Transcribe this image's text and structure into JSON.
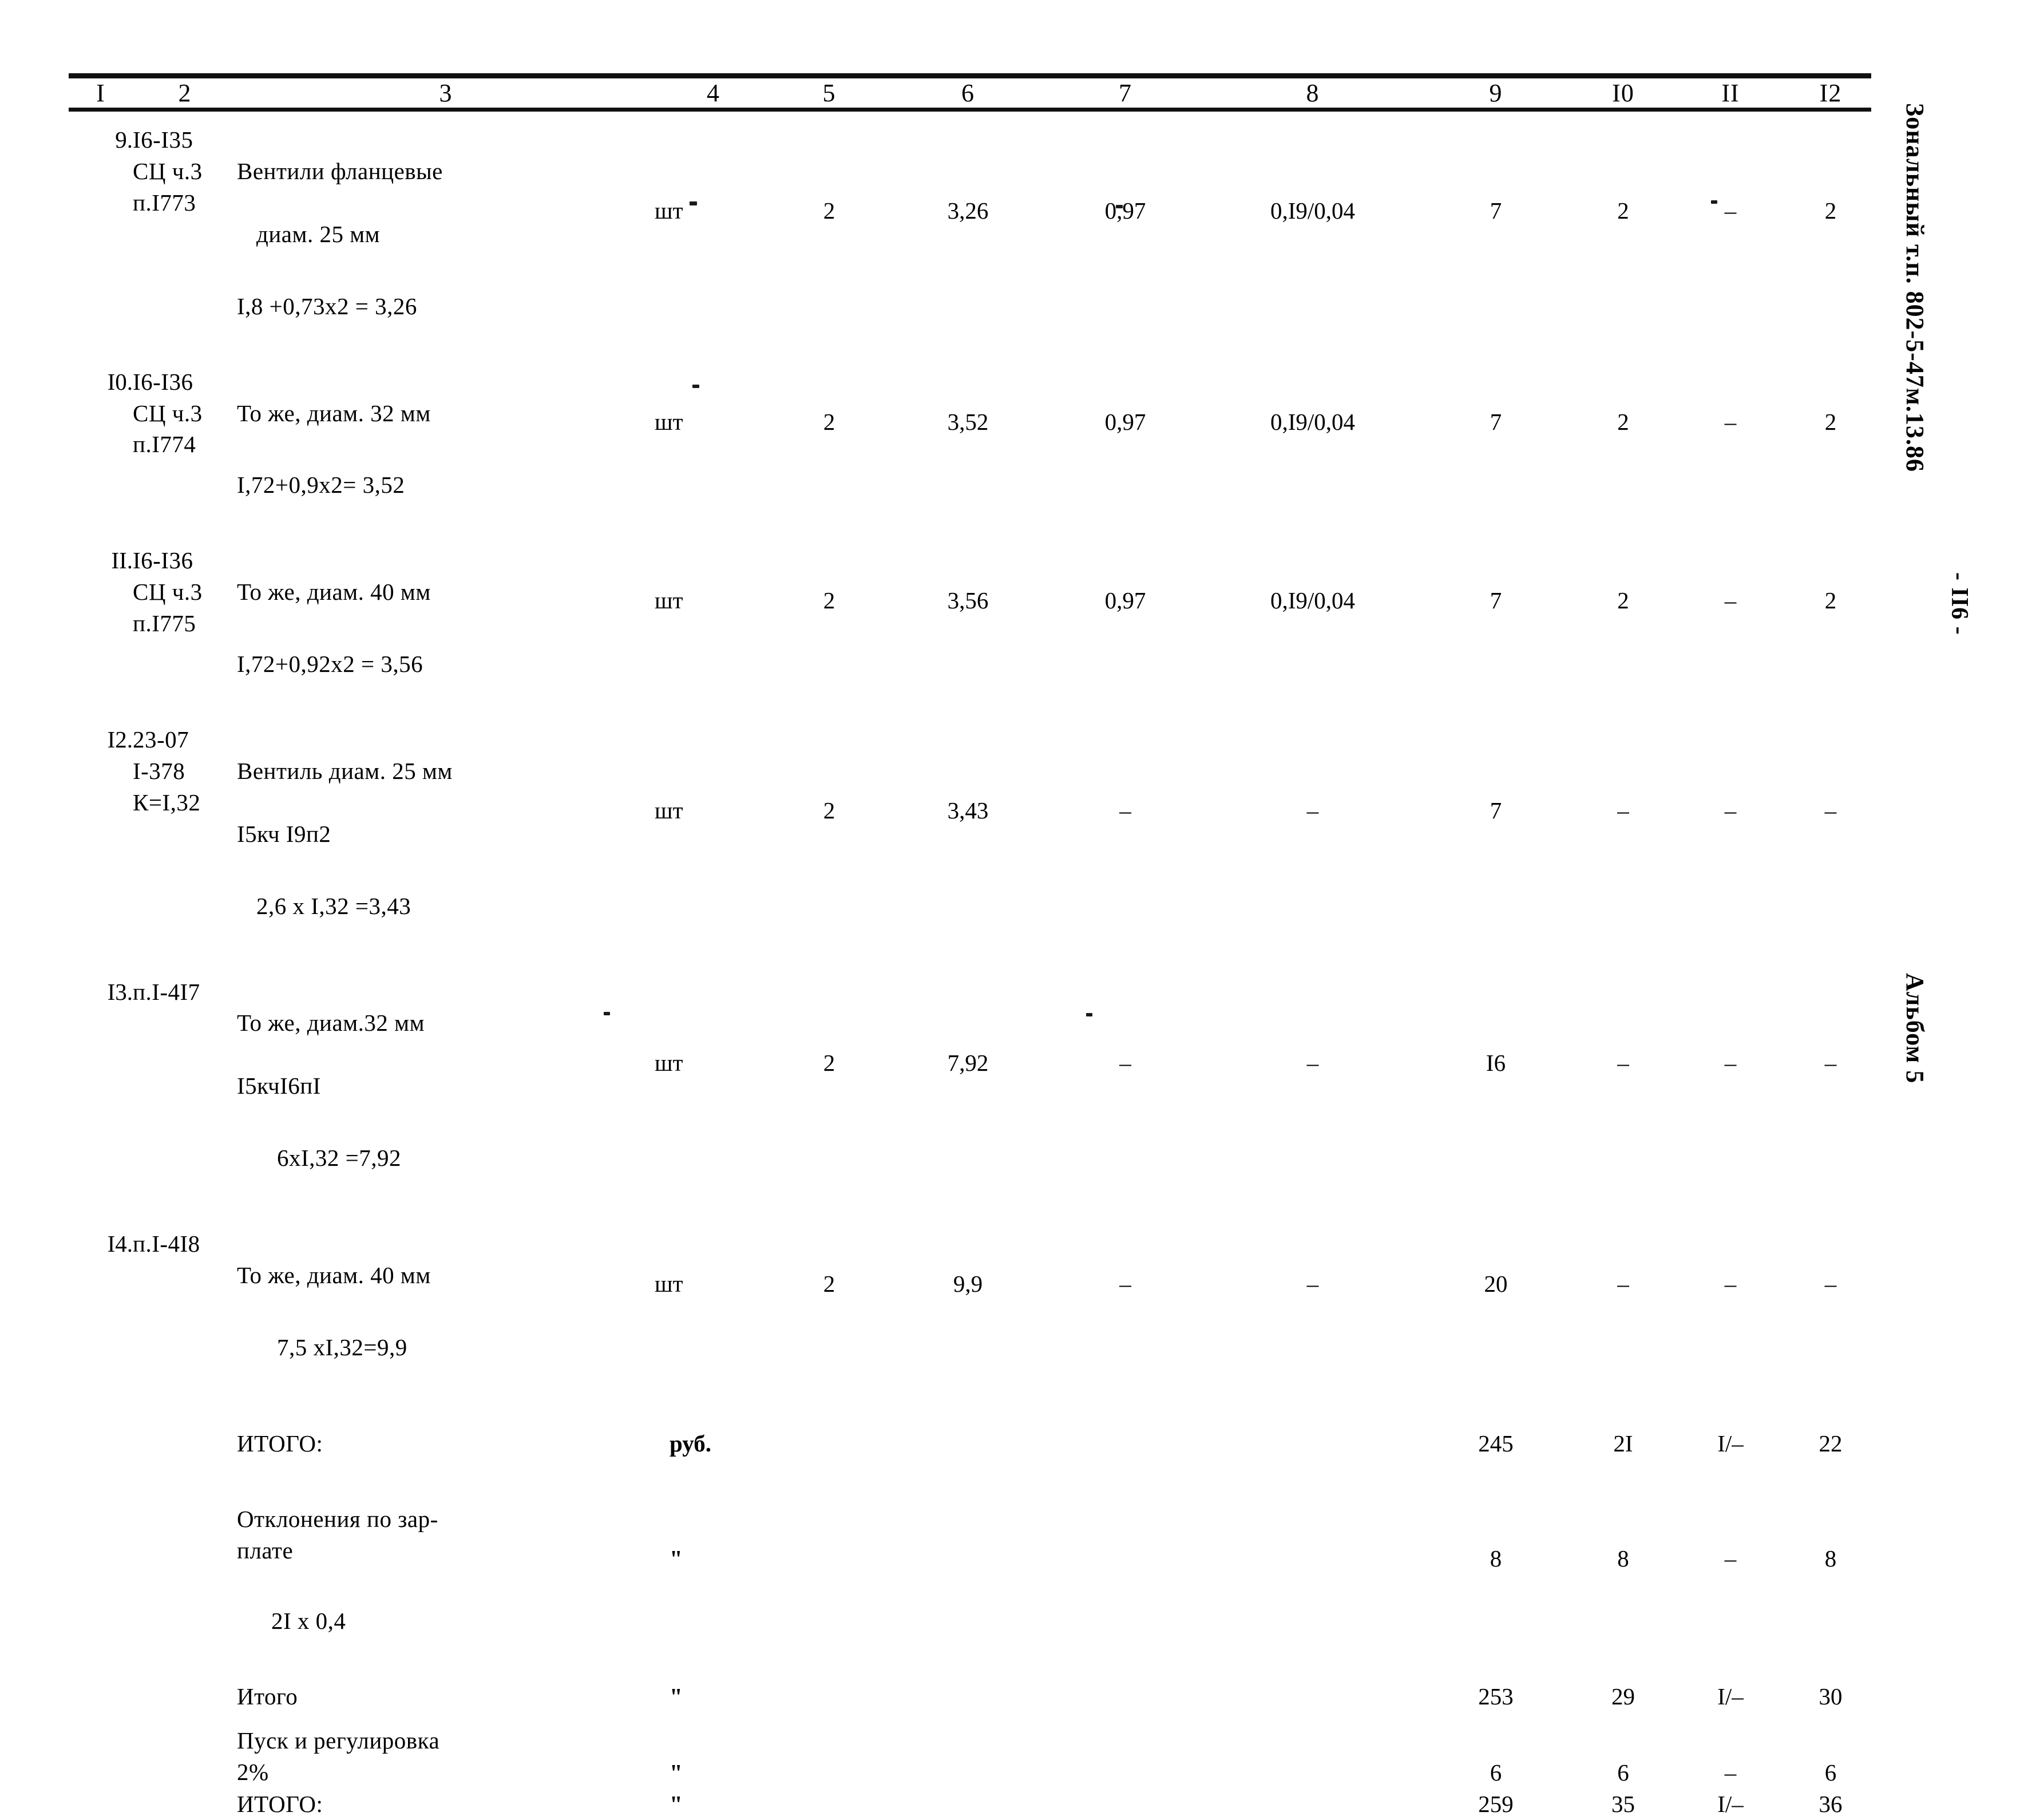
{
  "document": {
    "doc_ref": "Зональный т.п. 802-5-47м.13.86",
    "page_number": "- II6 -",
    "album_ref": "Альбом 5"
  },
  "table": {
    "column_headers": [
      "I",
      "2",
      "3",
      "4",
      "5",
      "6",
      "7",
      "8",
      "9",
      "I0",
      "II",
      "I2"
    ],
    "rows": [
      {
        "no": "9.",
        "code": "I6-I35\nСЦ ч.3\nп.I773",
        "desc_l1": "Вентили фланцевые",
        "desc_l2": "диам. 25 мм",
        "desc_l3": "I,8 +0,73х2 = 3,26",
        "unit": "шт",
        "c5": "2",
        "c6": "3,26",
        "c7": "0,97",
        "c8": "0,I9/0,04",
        "c9": "7",
        "c10": "2",
        "c11": "–",
        "c12": "2"
      },
      {
        "no": "I0.",
        "code": "I6-I36\nСЦ ч.3\nп.I774",
        "desc_l1": "То же, диам. 32 мм",
        "desc_l2": "",
        "desc_l3": "I,72+0,9х2= 3,52",
        "unit": "шт",
        "c5": "2",
        "c6": "3,52",
        "c7": "0,97",
        "c8": "0,I9/0,04",
        "c9": "7",
        "c10": "2",
        "c11": "–",
        "c12": "2"
      },
      {
        "no": "II.",
        "code": "I6-I36\nСЦ ч.3\nп.I775",
        "desc_l1": "То же, диам. 40 мм",
        "desc_l2": "",
        "desc_l3": "I,72+0,92х2 = 3,56",
        "unit": "шт",
        "c5": "2",
        "c6": "3,56",
        "c7": "0,97",
        "c8": "0,I9/0,04",
        "c9": "7",
        "c10": "2",
        "c11": "–",
        "c12": "2"
      },
      {
        "no": "I2.",
        "code": "23-07\nI-378\nК=I,32",
        "desc_l1": "Вентиль диам. 25 мм",
        "desc_l2": "I5кч I9п2",
        "desc_l3": "2,6 х I,32 =3,43",
        "unit": "шт",
        "c5": "2",
        "c6": "3,43",
        "c7": "–",
        "c8": "–",
        "c9": "7",
        "c10": "–",
        "c11": "–",
        "c12": "–"
      },
      {
        "no": "I3.",
        "code": "п.I-4I7",
        "desc_l1": "То же, диам.32 мм",
        "desc_l2": "I5кчI6пI",
        "desc_l3": "6хI,32 =7,92",
        "unit": "шт",
        "c5": "2",
        "c6": "7,92",
        "c7": "–",
        "c8": "–",
        "c9": "I6",
        "c10": "–",
        "c11": "–",
        "c12": "–"
      },
      {
        "no": "I4.",
        "code": "п.I-4I8",
        "desc_l1": "То же, диам. 40 мм",
        "desc_l2": "",
        "desc_l3": "7,5 хI,32=9,9",
        "unit": "шт",
        "c5": "2",
        "c6": "9,9",
        "c7": "–",
        "c8": "–",
        "c9": "20",
        "c10": "–",
        "c11": "–",
        "c12": "–"
      }
    ],
    "totals": [
      {
        "label": "ИТОГО:",
        "label_indented": "",
        "unit": "руб.",
        "c9": "245",
        "c10": "2I",
        "c11": "I/–",
        "c12": "22"
      },
      {
        "label": "Отклонения по зар-\nплате",
        "label_indented": "2I х 0,4",
        "unit": "\"",
        "c9": "8",
        "c10": "8",
        "c11": "–",
        "c12": "8"
      },
      {
        "label": "Итого",
        "label_indented": "",
        "unit": "\"",
        "c9": "253",
        "c10": "29",
        "c11": "I/–",
        "c12": "30"
      },
      {
        "label": "Пуск и регулировка\n2%",
        "label_indented": "",
        "unit": "\"",
        "c9": "6",
        "c10": "6",
        "c11": "–",
        "c12": "6"
      },
      {
        "label": "ИТОГО:",
        "label_indented": "",
        "unit": "\"",
        "c9": "259",
        "c10": "35",
        "c11": "I/–",
        "c12": "36"
      }
    ]
  }
}
